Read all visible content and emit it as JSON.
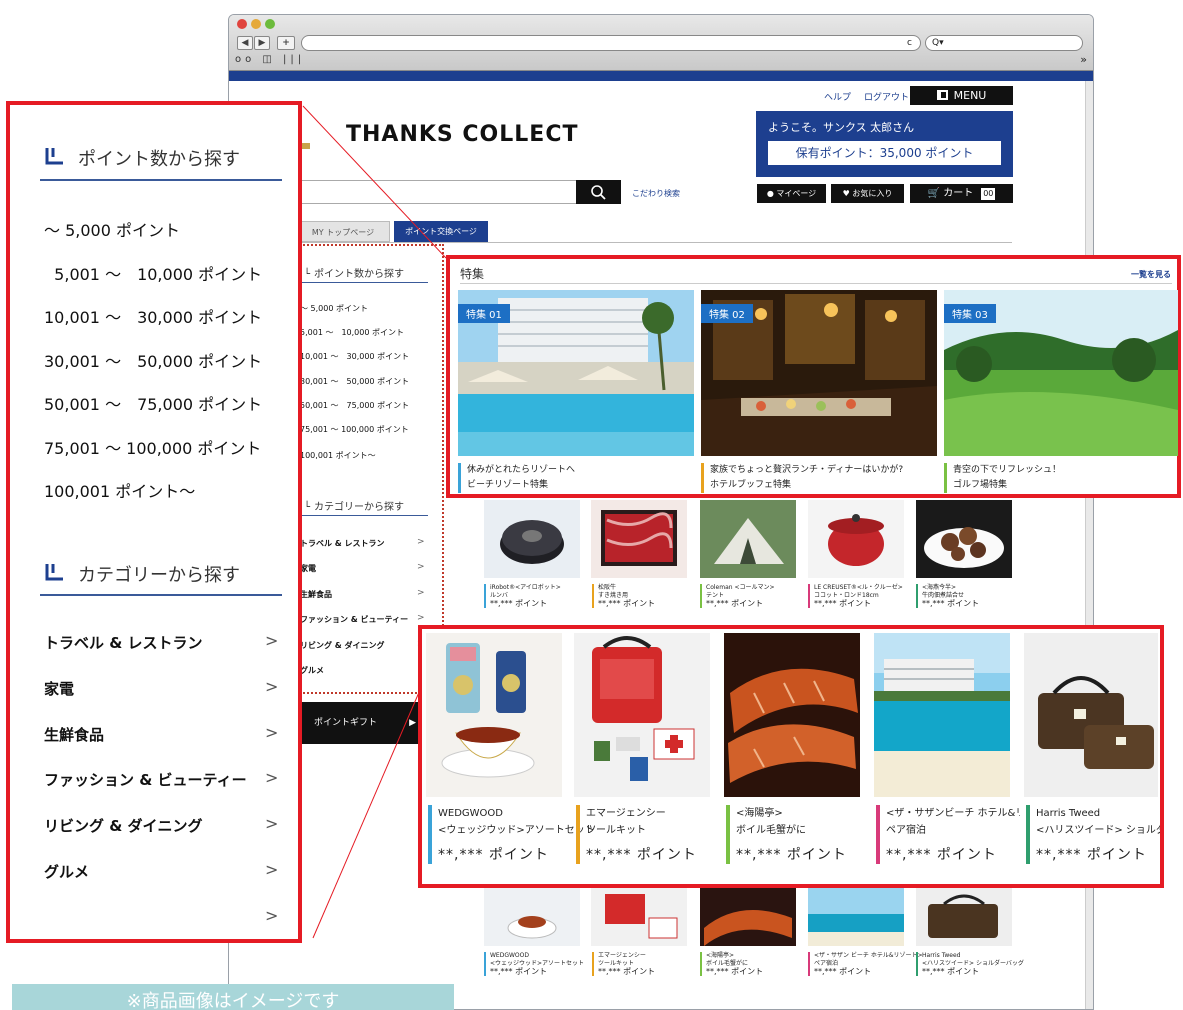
{
  "browser": {
    "nav_back": "◀",
    "nav_forward": "▶",
    "new_tab": "+",
    "reload": "c",
    "search_prefix": "Q▾",
    "bookmarks": "oo ◫ |||",
    "overflow": "»"
  },
  "header": {
    "help": "ヘルプ",
    "logout": "ログアウト",
    "menu": "MENU",
    "logo": "THANKS COLLECT",
    "welcome": "ようこそ。サンクス 太郎さん",
    "points_label": "保有ポイント：35,000 ポイント",
    "search_icon": "magnifier-icon",
    "advanced_search": "こだわり検索",
    "mypage": "マイページ",
    "favorites": "お気に入り",
    "cart": "カート",
    "cart_count": "00"
  },
  "tabs": [
    {
      "label": "MY トップページ"
    },
    {
      "label": "ポイント交換ページ"
    }
  ],
  "sidebar_small": {
    "points_heading": "ポイント数から探す",
    "points": [
      "～ 5,000 ポイント",
      "5,001 ～　10,000 ポイント",
      "10,001 ～　30,000 ポイント",
      "30,001 ～　50,000 ポイント",
      "50,001 ～　75,000 ポイント",
      "75,001 ～ 100,000 ポイント",
      "100,001 ポイント～"
    ],
    "category_heading": "カテゴリーから探す",
    "categories": [
      "トラベル & レストラン",
      "家電",
      "生鮮食品",
      "ファッション & ビューティー",
      "リビング & ダイニング",
      "グルメ"
    ],
    "gift_label": "ポイントギフト"
  },
  "zoom_sidebar": {
    "points_heading": "ポイント数から探す",
    "points": [
      "～ 5,000 ポイント",
      "  5,001 ～　10,000 ポイント",
      "10,001 ～　30,000 ポイント",
      "30,001 ～　50,000 ポイント",
      "50,001 ～　75,000 ポイント",
      "75,001 ～ 100,000 ポイント",
      "100,001 ポイント～"
    ],
    "category_heading": "カテゴリーから探す",
    "categories": [
      "トラベル & レストラン",
      "家電",
      "生鮮食品",
      "ファッション & ビューティー",
      "リビング & ダイニング",
      "グルメ",
      ""
    ],
    "arrow": ">"
  },
  "featured": {
    "heading": "特集",
    "see_all": "一覧を見る",
    "items": [
      {
        "tag": "特集 01",
        "line1": "休みがとれたらリゾートへ",
        "line2": "ビーチリゾート特集",
        "accent": "#3aa3d8"
      },
      {
        "tag": "特集 02",
        "line1": "家族でちょっと贅沢ランチ・ディナーはいかが?",
        "line2": "ホテルブッフェ特集",
        "accent": "#e8a21e"
      },
      {
        "tag": "特集 03",
        "line1": "青空の下でリフレッシュ！",
        "line2": "ゴルフ場特集",
        "accent": "#7ac143"
      }
    ]
  },
  "products_top": [
    {
      "name": "iRobot®<アイロボット>",
      "sub": "ルンバ",
      "price": "**,*** ポイント",
      "accent": "#3aa3d8"
    },
    {
      "name": "松阪牛",
      "sub": "すき焼き用",
      "price": "**,*** ポイント",
      "accent": "#e8a21e"
    },
    {
      "name": "Coleman <コールマン>",
      "sub": "テント",
      "price": "**,*** ポイント",
      "accent": "#7ac143"
    },
    {
      "name": "LE CREUSET®<ル・クルーゼ>",
      "sub": "ココット・ロンド18cm",
      "price": "**,*** ポイント",
      "accent": "#d83a7a"
    },
    {
      "name": "<海燕今半>",
      "sub": "牛肉佃煮詰合せ",
      "price": "**,*** ポイント",
      "accent": "#2f9e6e"
    }
  ],
  "products_zoom": [
    {
      "name": "WEDGWOOD",
      "sub": "<ウェッジウッド>アソートセット",
      "price": "**,*** ポイント",
      "accent": "#3aa3d8"
    },
    {
      "name": "エマージェンシー",
      "sub": "ツールキット",
      "price": "**,*** ポイント",
      "accent": "#e8a21e"
    },
    {
      "name": "<海陽亭>",
      "sub": "ボイル毛蟹がに",
      "price": "**,*** ポイント",
      "accent": "#7ac143"
    },
    {
      "name": "<ザ・サザンビーチ ホテル&リゾート>",
      "sub": "ペア宿泊",
      "price": "**,*** ポイント",
      "accent": "#d83a7a"
    },
    {
      "name": "Harris Tweed",
      "sub": "<ハリスツイード> ショルダーバッグ",
      "price": "**,*** ポイント",
      "accent": "#2f9e6e"
    }
  ],
  "products_bottom": [
    {
      "name": "WEDGWOOD",
      "sub": "<ウェッジウッド>アソートセット",
      "price": "**,*** ポイント",
      "accent": "#3aa3d8"
    },
    {
      "name": "エマージェンシー",
      "sub": "ツールキット",
      "price": "**,*** ポイント",
      "accent": "#e8a21e"
    },
    {
      "name": "<海陽亭>",
      "sub": "ボイル毛蟹がに",
      "price": "**,*** ポイント",
      "accent": "#7ac143"
    },
    {
      "name": "<ザ・サザン ビーチ ホテル&リゾート>",
      "sub": "ペア宿泊",
      "price": "**,*** ポイント",
      "accent": "#d83a7a"
    },
    {
      "name": "Harris Tweed",
      "sub": "<ハリスツイード> ショルダーバッグ",
      "price": "**,*** ポイント",
      "accent": "#2f9e6e"
    }
  ],
  "note": "※商品画像はイメージです",
  "colors": {
    "brand": "#1d3f8f",
    "highlight": "#e51b24",
    "note_bg": "#a8d6d9"
  }
}
